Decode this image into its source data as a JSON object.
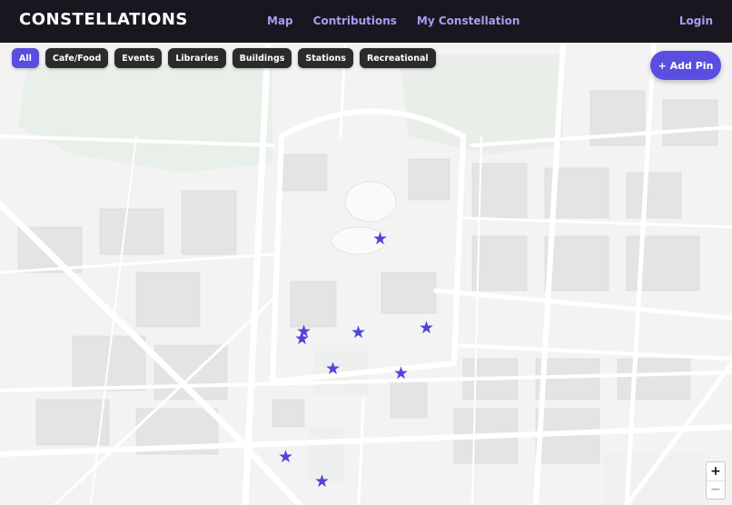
{
  "app": {
    "brand": "CONSTELLATIONS"
  },
  "nav": {
    "links": [
      "Map",
      "Contributions",
      "My Constellation"
    ],
    "login": "Login"
  },
  "filters": {
    "items": [
      "All",
      "Cafe/Food",
      "Events",
      "Libraries",
      "Buildings",
      "Stations",
      "Recreational"
    ],
    "active": "All"
  },
  "actions": {
    "add_pin": "+ Add Pin"
  },
  "map": {
    "zoom_in": "+",
    "zoom_out": "−",
    "pin_icon": "star-icon",
    "pin_glyph": "★",
    "pin_color": "#4f45d8",
    "accent": "#5a4de0"
  }
}
